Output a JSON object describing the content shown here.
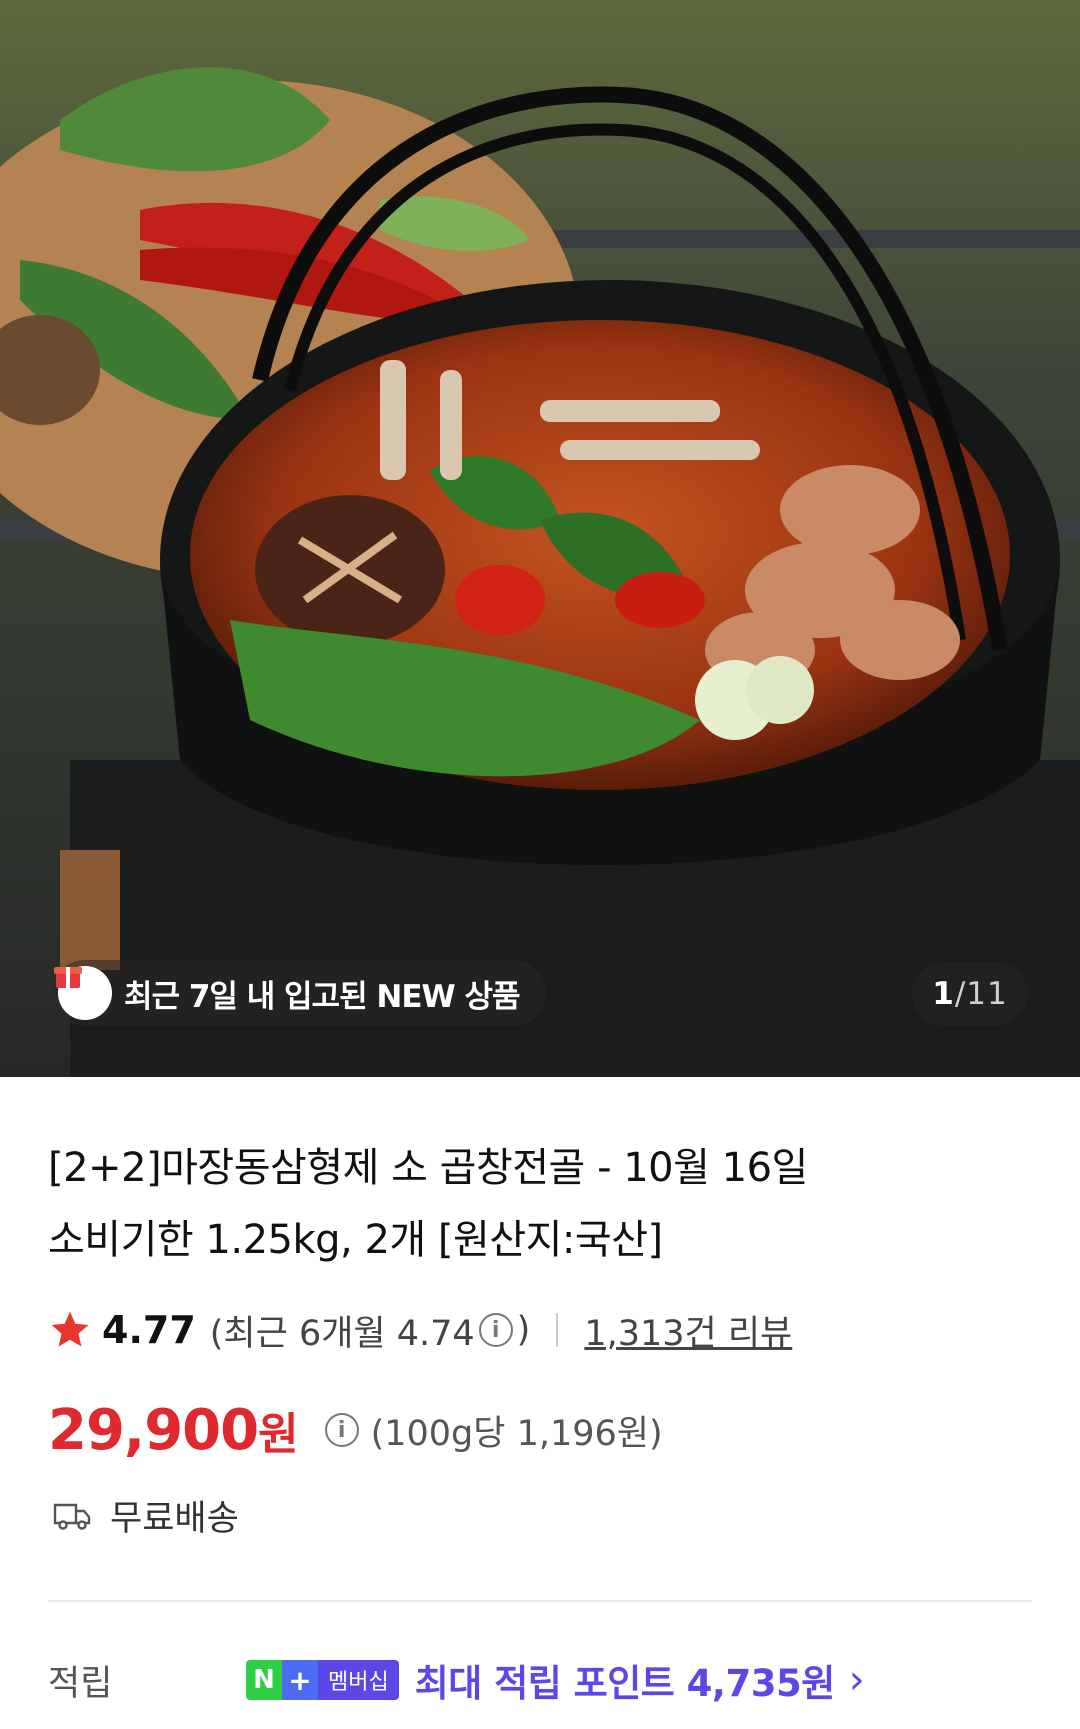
{
  "hero": {
    "image_alt": "곱창전골",
    "badge_text": "최근 7일 내 입고된 NEW 상품",
    "counter_current": "1",
    "counter_sep": "/",
    "counter_total": "11"
  },
  "product": {
    "title_line1": "[2+2]마장동삼형제 소 곱창전골 - 10월 16일",
    "title_line2": "소비기한 1.25kg, 2개 [원산지:국산]",
    "rating": "4.77",
    "recent_rating_prefix": "(최근 6개월 4.74",
    "recent_rating_suffix": ")",
    "reviews": "1,313건 리뷰",
    "price": "29,900",
    "price_unit": "원",
    "unit_price": "(100g당 1,196원)",
    "shipping": "무료배송"
  },
  "points": {
    "label": "적립",
    "badge_n": "N",
    "badge_plus": "+",
    "badge_membership": "멤버십",
    "text": "최대 적립 포인트 4,735원",
    "chevron": "›"
  },
  "colors": {
    "price": "#e0282f",
    "star": "#e8362d",
    "points": "#5b48e6",
    "npay_green": "#2ecf47"
  }
}
